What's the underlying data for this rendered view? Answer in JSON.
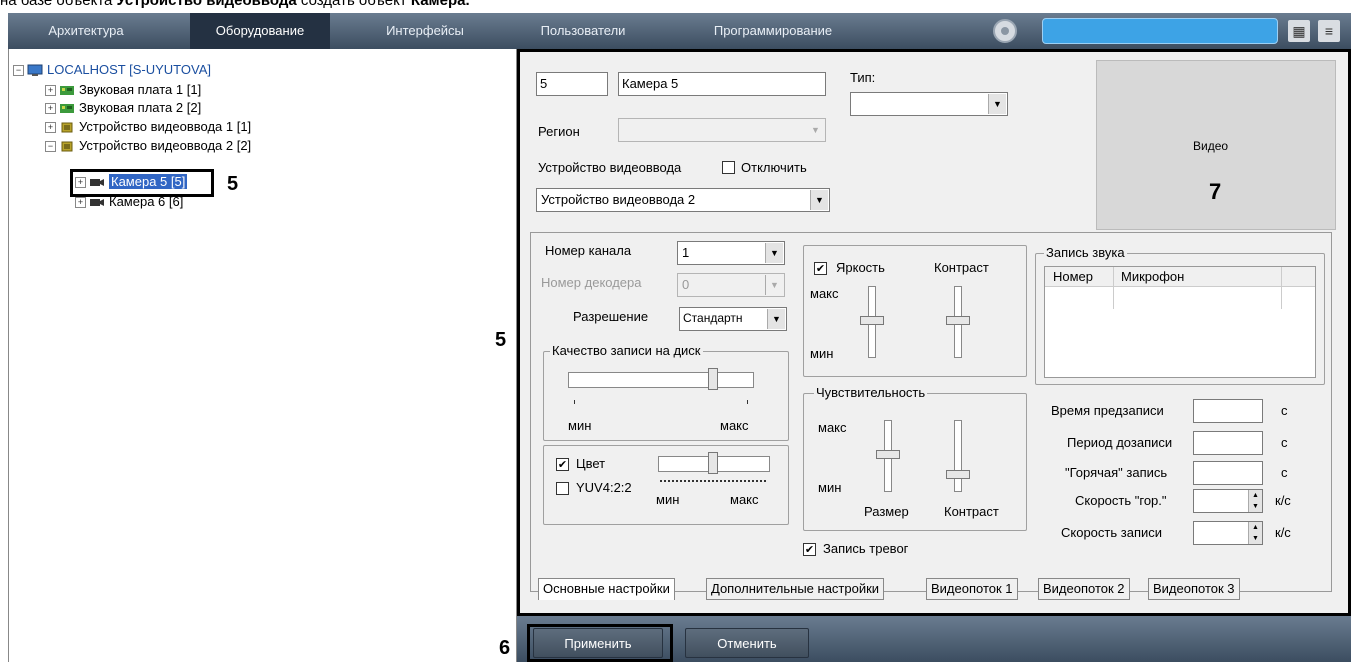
{
  "header_text": {
    "prefix": "на базе объекта ",
    "bold1": "Устройство видеоввода",
    "mid": " создать объект ",
    "bold2": "Камера."
  },
  "topbar": {
    "tabs": [
      "Архитектура",
      "Оборудование",
      "Интерфейсы",
      "Пользователи",
      "Программирование"
    ],
    "active_tab": "Оборудование"
  },
  "tree": {
    "root": "LOCALHOST [S-UYUTOVA]",
    "items": [
      "Звуковая плата 1 [1]",
      "Звуковая плата 2 [2]",
      "Устройство видеоввода 1 [1]",
      "Устройство видеоввода 2 [2]",
      "Камера 5 [5]",
      "Камера 6 [6]"
    ]
  },
  "markers": {
    "m5_tree": "5",
    "m5_panel": "5",
    "m6": "6",
    "m7": "7"
  },
  "camera": {
    "id": "5",
    "name": "Камера 5",
    "type_label": "Тип:",
    "type_value": "",
    "region_label": "Регион",
    "region_value": "",
    "device_label": "Устройство видеоввода",
    "disable_label": "Отключить",
    "disabled": false,
    "device_value": "Устройство видеоввода 2"
  },
  "video": {
    "label": "Видео"
  },
  "basic": {
    "channel_label": "Номер канала",
    "channel_value": "1",
    "decoder_label": "Номер декодера",
    "decoder_value": "0",
    "resolution_label": "Разрешение",
    "resolution_value": "Стандартн",
    "quality_title": "Качество записи на диск",
    "quality_min": "мин",
    "quality_max": "макс",
    "quality_level": 0.78,
    "color_label": "Цвет",
    "color_checked": true,
    "yuv_label": "YUV4:2:2",
    "yuv_checked": false,
    "color_min": "мин",
    "color_max": "макс"
  },
  "brightness": {
    "label": "Яркость",
    "checked": true,
    "contrast_label": "Контраст",
    "max": "макс",
    "min": "мин"
  },
  "sensitivity": {
    "title": "Чувствительность",
    "max": "макс",
    "min": "мин",
    "size_label": "Размер",
    "contrast_label": "Контраст"
  },
  "alarm_record": {
    "label": "Запись тревог",
    "checked": true
  },
  "sound": {
    "title": "Запись звука",
    "columns": [
      "Номер",
      "Микрофон"
    ]
  },
  "timing": {
    "prerecord_label": "Время предзаписи",
    "prerecord_unit": "с",
    "postrecord_label": "Период дозаписи",
    "postrecord_unit": "с",
    "hot_label": "\"Горячая\" запись",
    "hot_unit": "с",
    "hot_speed_label": "Скорость \"гор.\"",
    "hot_speed_unit": "к/с",
    "speed_label": "Скорость записи",
    "speed_unit": "к/с"
  },
  "tabs": [
    "Основные настройки",
    "Дополнительные настройки",
    "Видеопоток 1",
    "Видеопоток 2",
    "Видеопоток 3"
  ],
  "buttons": {
    "apply": "Применить",
    "cancel": "Отменить"
  }
}
